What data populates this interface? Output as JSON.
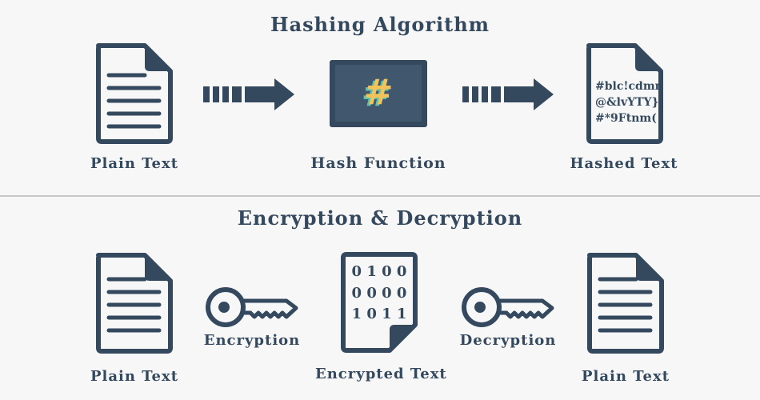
{
  "hashing": {
    "title": "Hashing Algorithm",
    "plain_label": "Plain Text",
    "function_label": "Hash Function",
    "function_symbol": "#",
    "hashed_label": "Hashed Text",
    "hashed_lines": [
      "#blc!cdmn",
      "@&lvYTY}",
      "#*9Ftnm("
    ]
  },
  "encryption": {
    "title": "Encryption & Decryption",
    "plain_label_left": "Plain Text",
    "encrypt_key_label": "Encryption",
    "encrypted_label": "Encrypted Text",
    "encrypted_lines": [
      "0 1 0 0",
      "0 0 0 0",
      "1 0 1 1"
    ],
    "decrypt_key_label": "Decryption",
    "plain_label_right": "Plain Text"
  },
  "colors": {
    "primary": "#34495e",
    "screen": "#41576e",
    "hash_yellow": "#f3c35a",
    "hash_teal": "#5bc4b0",
    "divider": "#c6c7c9",
    "background": "#f7f7f8"
  }
}
